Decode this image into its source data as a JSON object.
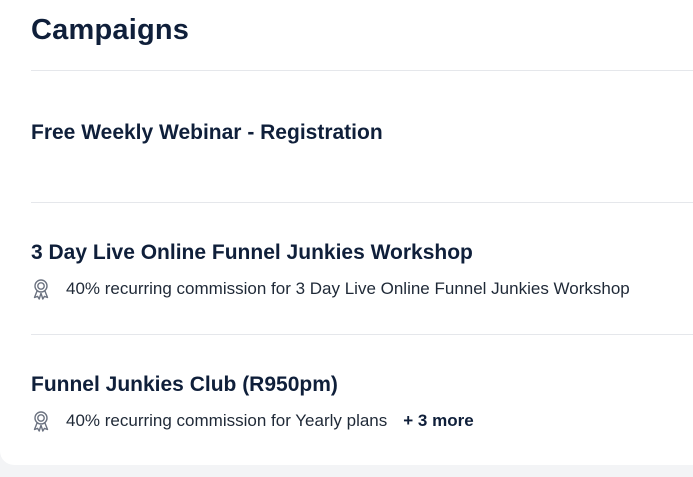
{
  "page": {
    "title": "Campaigns"
  },
  "campaigns": [
    {
      "name": "Free Weekly Webinar - Registration"
    },
    {
      "name": "3 Day Live Online Funnel Junkies Workshop",
      "commission": "40% recurring commission for 3 Day Live Online Funnel Junkies Workshop",
      "icon": "award-icon"
    },
    {
      "name": "Funnel Junkies Club (R950pm)",
      "commission": "40% recurring commission for Yearly plans",
      "more": "+ 3 more",
      "icon": "award-icon"
    }
  ],
  "colors": {
    "text": "#0f1f3a",
    "divider": "#e5e7eb",
    "background": "#f3f4f6"
  }
}
